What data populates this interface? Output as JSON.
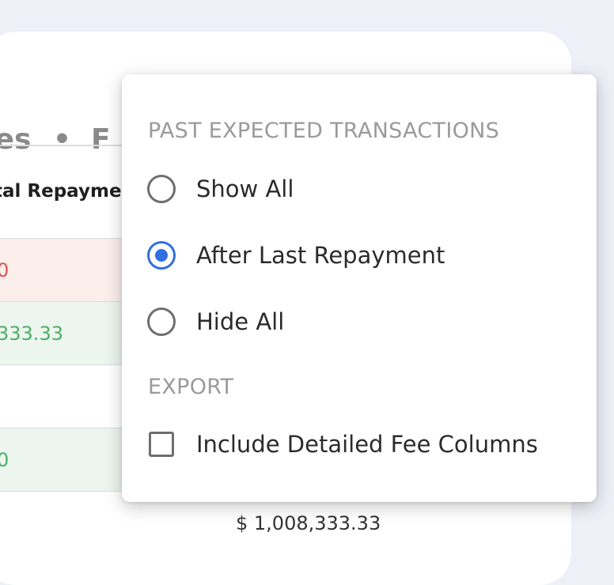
{
  "background": {
    "tab_left": "ties",
    "tab_separator": "•",
    "tab_right": "F",
    "column_header": "tal Repayme",
    "rows": [
      {
        "value": "0",
        "status": "red"
      },
      {
        "value": "333.33",
        "status": "green"
      },
      {
        "value": "",
        "status": "plain"
      },
      {
        "value": "0",
        "status": "green"
      }
    ],
    "footer_total": "$ 1,008,333.33"
  },
  "menu": {
    "past_section_title": "PAST EXPECTED TRANSACTIONS",
    "options": [
      {
        "label": "Show All",
        "checked": false
      },
      {
        "label": "After Last Repayment",
        "checked": true
      },
      {
        "label": "Hide All",
        "checked": false
      }
    ],
    "export_section_title": "EXPORT",
    "export_option": {
      "label": "Include Detailed Fee Columns",
      "checked": false
    }
  },
  "colors": {
    "accent": "#2f6fe0",
    "negative": "#d9534f",
    "positive": "#4caf67"
  }
}
